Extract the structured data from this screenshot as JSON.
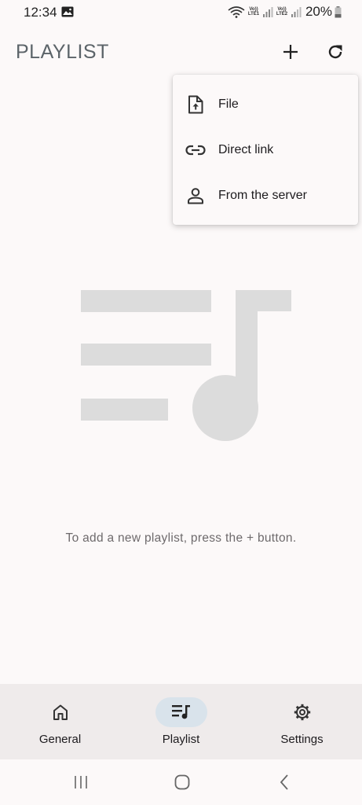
{
  "status_bar": {
    "time": "12:34",
    "sim1_label": "Vo)) LTE1",
    "sim2_label": "Vo)) LTE2",
    "battery": "20%"
  },
  "app_bar": {
    "title": "PLAYLIST",
    "add_icon": "plus-icon",
    "refresh_icon": "refresh-icon"
  },
  "add_menu": {
    "items": [
      {
        "label": "File",
        "icon": "file-upload-icon"
      },
      {
        "label": "Direct link",
        "icon": "link-icon"
      },
      {
        "label": "From the server",
        "icon": "person-icon"
      }
    ]
  },
  "empty_state": {
    "message": "To add a new playlist, press the + button.",
    "illustration": "playlist-music-icon"
  },
  "bottom_nav": {
    "items": [
      {
        "label": "General",
        "icon": "home-icon",
        "active": false
      },
      {
        "label": "Playlist",
        "icon": "playlist-icon",
        "active": true
      },
      {
        "label": "Settings",
        "icon": "gear-icon",
        "active": false
      }
    ]
  },
  "colors": {
    "background": "#fcf9f9",
    "title": "#5c6469",
    "nav_background": "#efebeb",
    "nav_active_pill": "#d9e3eb",
    "illustration": "#dcdcdc"
  }
}
